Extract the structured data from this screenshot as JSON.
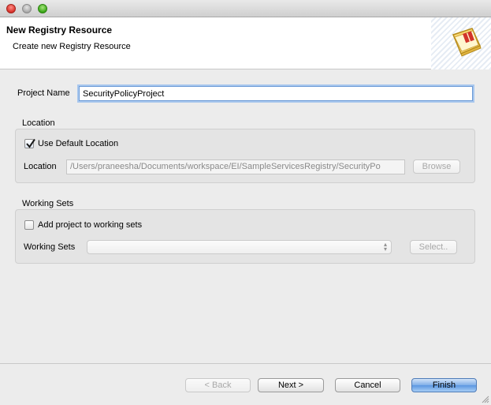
{
  "window": {
    "controls": [
      "close",
      "minimize",
      "maximize"
    ]
  },
  "header": {
    "title": "New Registry Resource",
    "subtitle": "Create new Registry Resource",
    "icon": "wizard-book-icon"
  },
  "form": {
    "project_name_label": "Project Name",
    "project_name_value": "SecurityPolicyProject",
    "location_group": {
      "title": "Location",
      "use_default_label": "Use Default Location",
      "use_default_checked": true,
      "location_label": "Location",
      "location_value": "/Users/praneesha/Documents/workspace/EI/SampleServicesRegistry/SecurityPo",
      "browse_label": "Browse"
    },
    "working_sets_group": {
      "title": "Working Sets",
      "add_label": "Add project to working sets",
      "add_checked": false,
      "working_sets_label": "Working Sets",
      "working_sets_value": "",
      "select_label": "Select.."
    }
  },
  "footer": {
    "back_label": "< Back",
    "next_label": "Next >",
    "cancel_label": "Cancel",
    "finish_label": "Finish"
  },
  "colors": {
    "default_button": "#5b97e1",
    "focus_ring": "#a8c7ee",
    "panel_bg": "#ececec"
  }
}
